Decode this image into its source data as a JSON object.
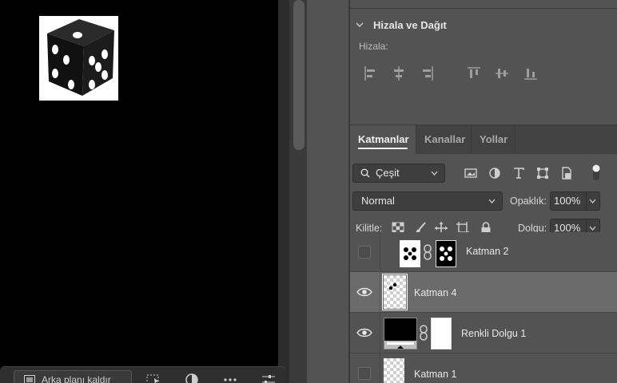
{
  "context_bar": {
    "remove_bg_label": "Arka planı kaldır",
    "icons": [
      "remove-bg-icon",
      "select-subject-icon",
      "mask-icon",
      "more-icon",
      "settings-sliders-icon"
    ]
  },
  "align_panel": {
    "title": "Hizala ve Dağıt",
    "sub_label": "Hizala:",
    "buttons": [
      "align-left-icon",
      "align-horizontal-center-icon",
      "align-right-icon",
      "align-top-icon",
      "align-vertical-center-icon",
      "align-bottom-icon"
    ]
  },
  "layers_panel": {
    "tabs": [
      {
        "label": "Katmanlar",
        "active": true
      },
      {
        "label": "Kanallar",
        "active": false
      },
      {
        "label": "Yollar",
        "active": false
      }
    ],
    "filter": {
      "value": "Çeşit"
    },
    "blend_mode": "Normal",
    "opacity_label": "Opaklık:",
    "opacity_value": "100%",
    "lock_label": "Kilitle:",
    "fill_label": "Dolgu:",
    "fill_value": "100%",
    "layers": [
      {
        "name": "Katman 2",
        "visible": false,
        "selected": false
      },
      {
        "name": "Katman 4",
        "visible": true,
        "selected": true
      },
      {
        "name": "Renkli Dolgu 1",
        "visible": true,
        "selected": false
      },
      {
        "name": "Katman 1",
        "visible": false,
        "selected": false
      }
    ]
  },
  "colors": {
    "panel_bg": "#535353",
    "selected_row": "#6b6b6b",
    "canvas": "#000000"
  }
}
